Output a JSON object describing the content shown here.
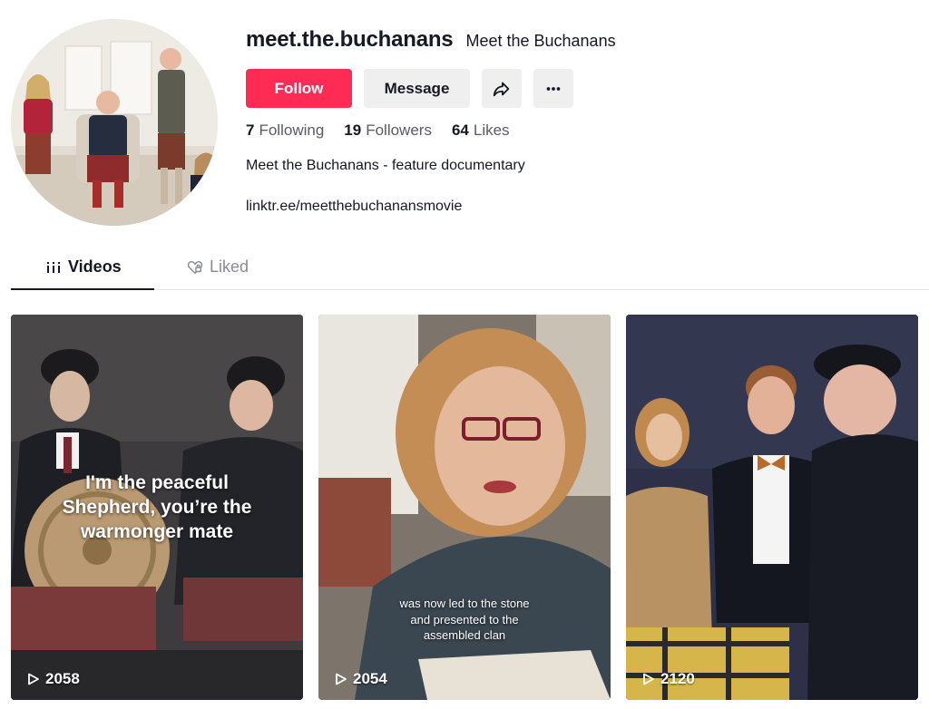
{
  "profile": {
    "handle": "meet.the.buchanans",
    "nickname": "Meet the Buchanans",
    "bio": "Meet the Buchanans - feature documentary",
    "link": "linktr.ee/meetthebuchanansmovie",
    "avatar_icon": "family-portrait-avatar"
  },
  "actions": {
    "follow_label": "Follow",
    "message_label": "Message",
    "share_icon": "share-arrow-icon",
    "more_icon": "more-dots-icon"
  },
  "stats": {
    "following_count": "7",
    "following_label": "Following",
    "followers_count": "19",
    "followers_label": "Followers",
    "likes_count": "64",
    "likes_label": "Likes"
  },
  "tabs": [
    {
      "label": "Videos",
      "icon": "grid-bars-icon",
      "active": true
    },
    {
      "label": "Liked",
      "icon": "heart-lock-icon",
      "active": false
    }
  ],
  "videos": [
    {
      "caption": [
        "I'm the peaceful",
        "Shepherd, you’re the",
        "warmonger mate"
      ],
      "views": "2058"
    },
    {
      "caption": [
        "was now led to the stone",
        "and presented to the",
        "assembled clan"
      ],
      "views": "2054"
    },
    {
      "caption": [],
      "views": "2120"
    }
  ],
  "colors": {
    "accent": "#fe2c55",
    "button_grey": "#efeff0",
    "text_primary": "#161823",
    "text_secondary": "#5a5b62"
  }
}
